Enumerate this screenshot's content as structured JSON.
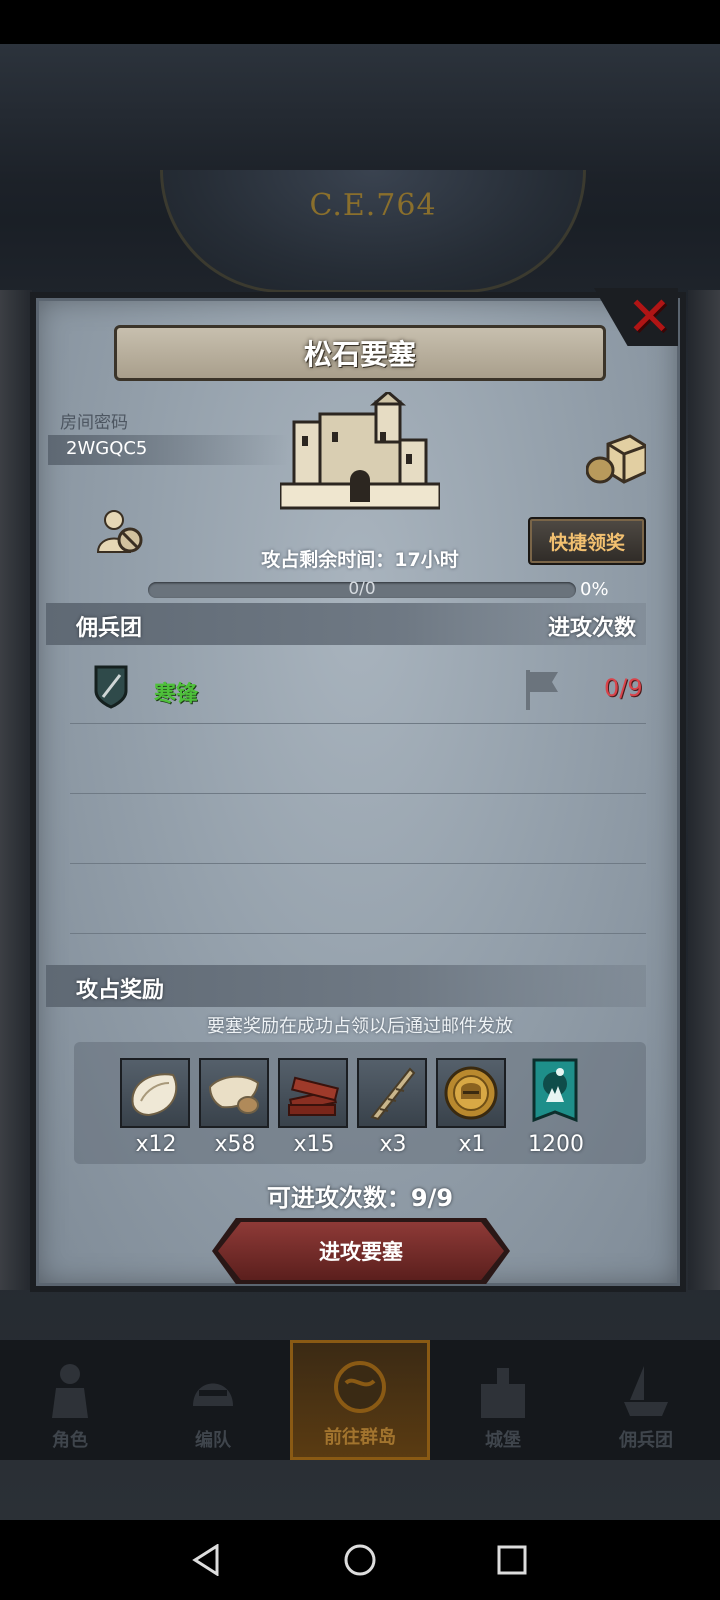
{
  "header": {
    "era": "C.E.764"
  },
  "dialog": {
    "title": "松石要塞",
    "room_password_label": "房间密码",
    "room_code": "2WGQC5",
    "quick_claim": "快捷领奖",
    "timer_text": "攻占剩余时间：17小时",
    "progress_count": "0/0",
    "progress_percent": "0%",
    "progress_fraction": 0,
    "mercenary_header": "佣兵团",
    "attack_count_header": "进攻次数",
    "mercenaries": [
      {
        "name": "寒锋",
        "attacks": "0/9"
      }
    ],
    "rewards_header": "攻占奖励",
    "reward_note": "要塞奖励在成功占领以后通过邮件发放",
    "rewards": [
      {
        "icon": "fur-pelt-icon",
        "qty": "x12"
      },
      {
        "icon": "hide-icon",
        "qty": "x58"
      },
      {
        "icon": "wood-planks-icon",
        "qty": "x15"
      },
      {
        "icon": "horn-icon",
        "qty": "x3"
      },
      {
        "icon": "knight-medal-icon",
        "qty": "x1"
      },
      {
        "icon": "banner-icon",
        "qty": "1200"
      }
    ],
    "can_attack": "可进攻次数：9/9",
    "attack_button": "进攻要塞"
  },
  "nav": [
    {
      "label": "角色",
      "icon": "knight-icon"
    },
    {
      "label": "编队",
      "icon": "helmet-icon"
    },
    {
      "label": "前往群岛",
      "icon": "globe-icon",
      "active": true
    },
    {
      "label": "城堡",
      "icon": "castle-icon"
    },
    {
      "label": "佣兵团",
      "icon": "ship-icon"
    }
  ],
  "colors": {
    "accent_green": "#4ec03a",
    "accent_red": "#d9434a",
    "close_red": "#b01515",
    "quick_gold": "#f2c070"
  }
}
